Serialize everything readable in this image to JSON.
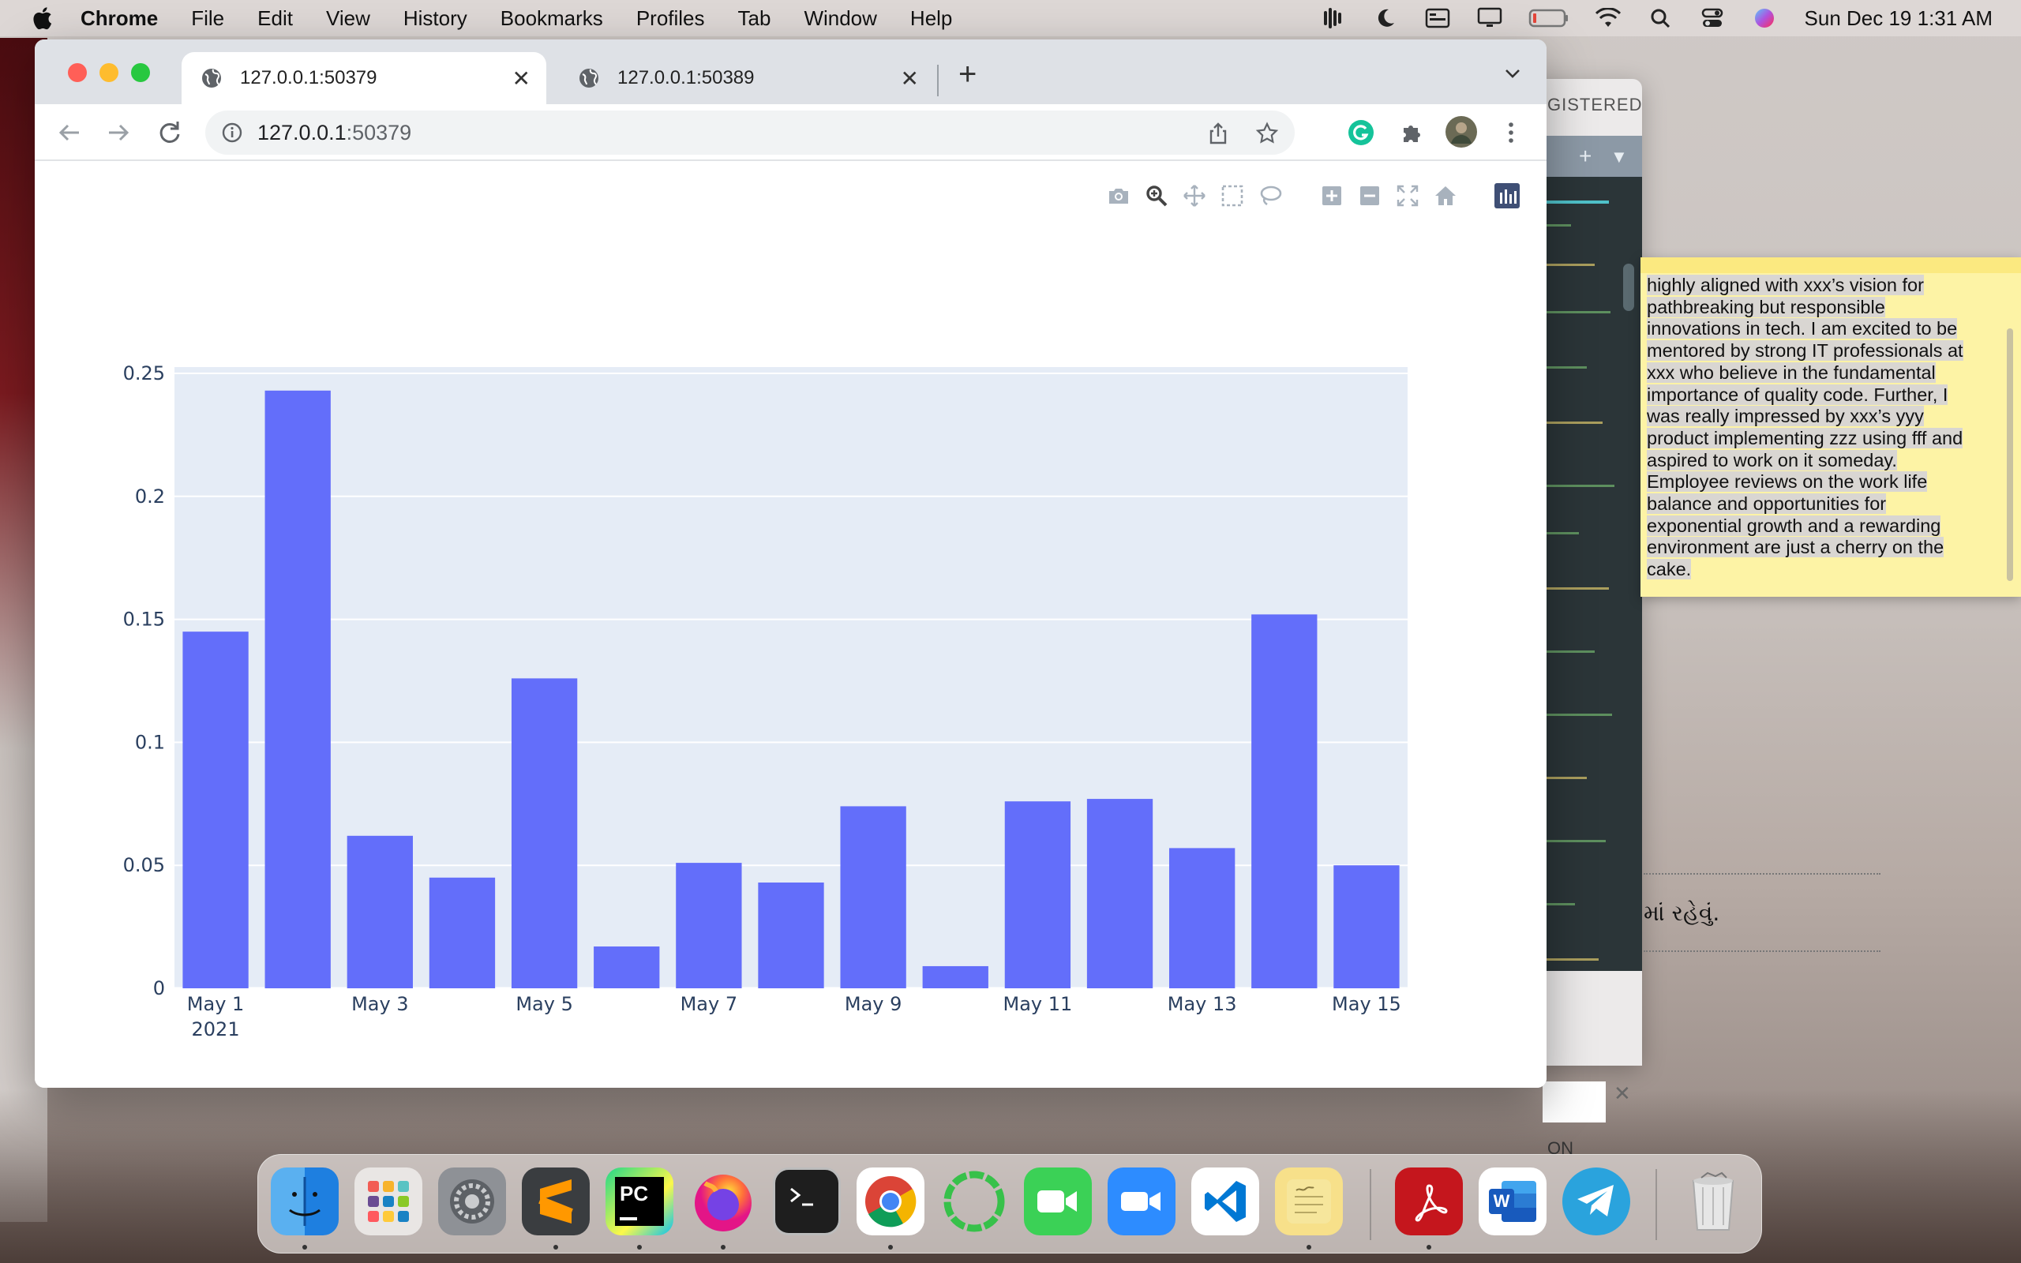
{
  "menubar": {
    "app_name": "Chrome",
    "items": [
      "File",
      "Edit",
      "View",
      "History",
      "Bookmarks",
      "Profiles",
      "Tab",
      "Window",
      "Help"
    ],
    "clock": "Sun Dec 19  1:31 AM",
    "status_icons": [
      "audio-bars-icon",
      "moon-icon",
      "display-menu-icon",
      "airplay-icon",
      "battery-icon",
      "wifi-icon",
      "spotlight-search-icon",
      "control-center-icon",
      "siri-icon"
    ]
  },
  "browser": {
    "tabs": [
      {
        "title": "127.0.0.1:50379",
        "active": true
      },
      {
        "title": "127.0.0.1:50389",
        "active": false
      }
    ],
    "url_host": "127.0.0.1",
    "url_port": ":50379",
    "extension_colors": {
      "grammarly": "#15c39a"
    }
  },
  "plot": {
    "modebar": [
      "camera-icon",
      "zoom-icon",
      "pan-icon",
      "box-select-icon",
      "lasso-icon",
      "zoom-in-icon",
      "zoom-out-icon",
      "autoscale-icon",
      "reset-axes-icon",
      "plotly-logo-icon"
    ]
  },
  "chart_data": {
    "type": "bar",
    "categories": [
      "2021-05-01",
      "2021-05-02",
      "2021-05-03",
      "2021-05-04",
      "2021-05-05",
      "2021-05-06",
      "2021-05-07",
      "2021-05-08",
      "2021-05-09",
      "2021-05-10",
      "2021-05-11",
      "2021-05-12",
      "2021-05-13",
      "2021-05-14",
      "2021-05-15"
    ],
    "values": [
      0.145,
      0.243,
      0.062,
      0.045,
      0.126,
      0.017,
      0.051,
      0.043,
      0.074,
      0.009,
      0.076,
      0.077,
      0.057,
      0.152,
      0.05
    ],
    "ylim": [
      0,
      0.25
    ],
    "y_ticks": [
      "0",
      "0.05",
      "0.1",
      "0.15",
      "0.2",
      "0.25"
    ],
    "x_ticks": [
      "May 1",
      "May 3",
      "May 5",
      "May 7",
      "May 9",
      "May 11",
      "May 13",
      "May 15"
    ],
    "x_tick_year": "2021",
    "bar_color": "#636efa",
    "plot_bg": "#e5ecf6",
    "grid": true
  },
  "back_window": {
    "title": "GISTERED",
    "footer_label": "ON"
  },
  "sticky_note": {
    "lines": [
      "highly aligned with xxx’s vision for",
      "pathbreaking but responsible",
      "innovations in tech. I am excited to be",
      "mentored by strong IT professionals at",
      "xxx who believe in the fundamental",
      "importance of quality code. Further, I",
      "was really impressed by xxx’s yyy",
      "product implementing zzz using fff and",
      "aspired to work on it someday.",
      "Employee reviews on the work life",
      "balance and opportunities for",
      "exponential growth and a rewarding",
      "environment are just a cherry on the",
      "cake."
    ],
    "background": "#fdf3a5"
  },
  "gujarati_snippet": "માં રહેવું.",
  "dock": {
    "apps": [
      "finder-icon",
      "launchpad-icon",
      "system-preferences-icon",
      "sublime-text-icon",
      "pycharm-icon",
      "firefox-icon",
      "terminal-icon",
      "chrome-icon",
      "activity-ring-icon",
      "facetime-icon",
      "zoom-icon",
      "vscode-icon",
      "notes-icon",
      "acrobat-icon",
      "word-icon",
      "telegram-icon",
      "trash-icon"
    ],
    "pycharm_label": "PC",
    "word_label": "W"
  }
}
